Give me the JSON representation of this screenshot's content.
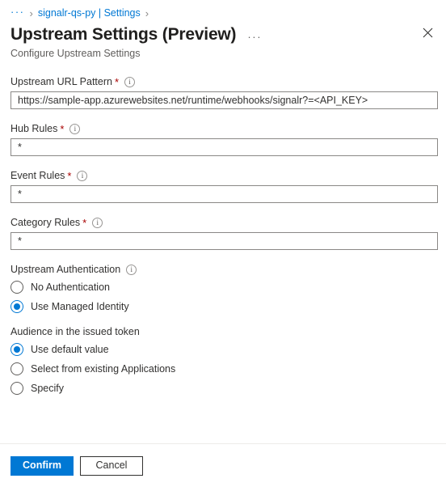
{
  "breadcrumb": {
    "ellipsis": "···",
    "separator": "›",
    "link": "signalr-qs-py | Settings",
    "trailing_separator": "›"
  },
  "header": {
    "title": "Upstream Settings (Preview)",
    "more_menu": "···",
    "close_icon": "close-icon",
    "subtitle": "Configure Upstream Settings"
  },
  "fields": [
    {
      "label": "Upstream URL Pattern",
      "required": "*",
      "info_icon": "info-icon",
      "value": "https://sample-app.azurewebsites.net/runtime/webhooks/signalr?=<API_KEY>",
      "placeholder": ""
    },
    {
      "label": "Hub Rules",
      "required": "*",
      "info_icon": "info-icon",
      "value": "*",
      "placeholder": ""
    },
    {
      "label": "Event Rules",
      "required": "*",
      "info_icon": "info-icon",
      "value": "*",
      "placeholder": ""
    },
    {
      "label": "Category Rules",
      "required": "*",
      "info_icon": "info-icon",
      "value": "*",
      "placeholder": ""
    }
  ],
  "auth_group": {
    "label": "Upstream Authentication",
    "info_icon": "info-icon",
    "options": [
      {
        "label": "No Authentication",
        "selected": false
      },
      {
        "label": "Use Managed Identity",
        "selected": true
      }
    ]
  },
  "audience_group": {
    "label": "Audience in the issued token",
    "options": [
      {
        "label": "Use default value",
        "selected": true
      },
      {
        "label": "Select from existing Applications",
        "selected": false
      },
      {
        "label": "Specify",
        "selected": false
      }
    ]
  },
  "footer": {
    "confirm_label": "Confirm",
    "cancel_label": "Cancel"
  },
  "colors": {
    "accent": "#0078d4",
    "required_star": "#a80000",
    "link": "#0078d4",
    "text": "#323130",
    "subtle_text": "#605e5c",
    "border": "#8a8886"
  }
}
